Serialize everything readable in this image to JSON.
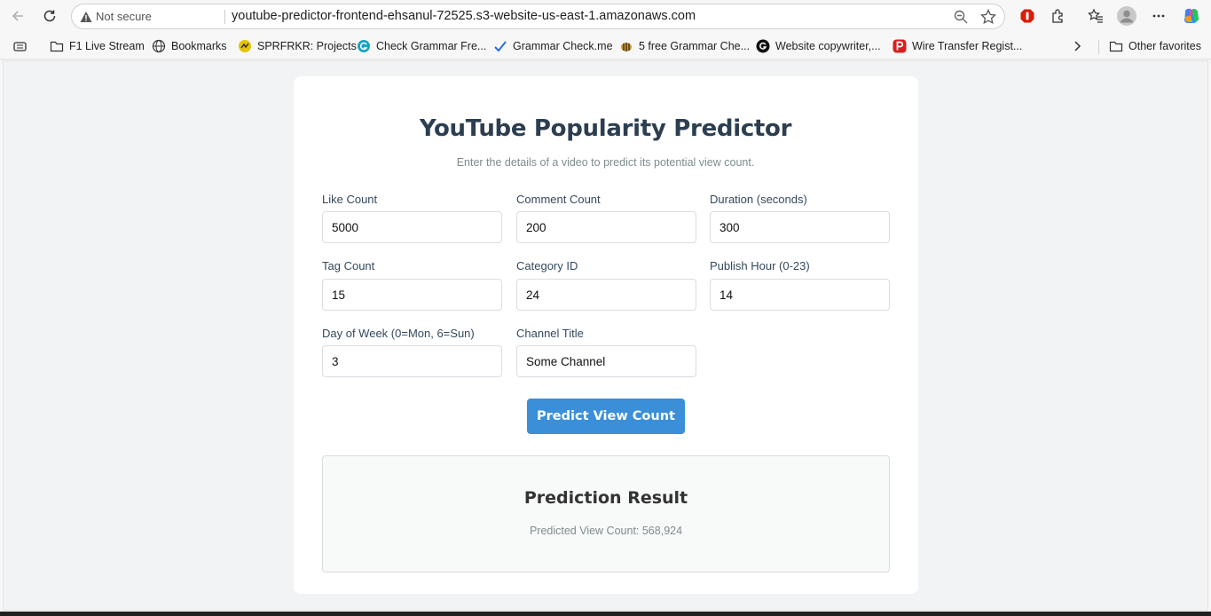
{
  "browser": {
    "not_secure": "Not secure",
    "url": "youtube-predictor-frontend-ehsanul-72525.s3-website-us-east-1.amazonaws.com",
    "bookmarks": [
      {
        "label": "F1 Live Stream",
        "icon": "folder-icon"
      },
      {
        "label": "Bookmarks",
        "icon": "globe-icon"
      },
      {
        "label": "SPRFRKR: Projects",
        "icon": "sprfrkr-icon"
      },
      {
        "label": "Check Grammar Fre...",
        "icon": "grammar-g-icon"
      },
      {
        "label": "Grammar Check.me",
        "icon": "checkmark-icon"
      },
      {
        "label": "5 free Grammar Che...",
        "icon": "bee-icon"
      },
      {
        "label": "Website copywriter,...",
        "icon": "g-circle-icon"
      },
      {
        "label": "Wire Transfer Regist...",
        "icon": "p-logo-icon"
      }
    ],
    "other_favorites": "Other favorites"
  },
  "page": {
    "title": "YouTube Popularity Predictor",
    "subtitle": "Enter the details of a video to predict its potential view count.",
    "fields": [
      {
        "label": "Like Count",
        "value": "5000"
      },
      {
        "label": "Comment Count",
        "value": "200"
      },
      {
        "label": "Duration (seconds)",
        "value": "300"
      },
      {
        "label": "Tag Count",
        "value": "15"
      },
      {
        "label": "Category ID",
        "value": "24"
      },
      {
        "label": "Publish Hour (0-23)",
        "value": "14"
      },
      {
        "label": "Day of Week (0=Mon, 6=Sun)",
        "value": "3"
      },
      {
        "label": "Channel Title",
        "value": "Some Channel"
      }
    ],
    "button": "Predict View Count",
    "result": {
      "title": "Prediction Result",
      "text": "Predicted View Count: 568,924"
    }
  },
  "colors": {
    "accent": "#3a8fd8",
    "heading": "#2c3e50"
  }
}
